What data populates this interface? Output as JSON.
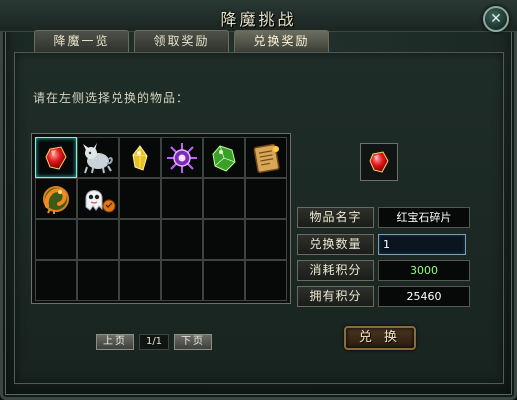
{
  "window": {
    "title": "降魔挑战"
  },
  "tabs": [
    {
      "label": "降魔一览",
      "active": false
    },
    {
      "label": "领取奖励",
      "active": false
    },
    {
      "label": "兑换奖励",
      "active": true
    }
  ],
  "prompt": "请在左侧选择兑换的物品：",
  "inventory": {
    "items": [
      {
        "icon": "red-gem-icon",
        "selected": true
      },
      {
        "icon": "white-mount-icon",
        "selected": false
      },
      {
        "icon": "yellow-crystal-icon",
        "selected": false
      },
      {
        "icon": "purple-orb-icon",
        "selected": false
      },
      {
        "icon": "green-crystal-icon",
        "selected": false
      },
      {
        "icon": "scroll-book-icon",
        "selected": false
      },
      {
        "icon": "orange-lizard-pet-icon",
        "selected": false
      },
      {
        "icon": "ghost-pet-icon",
        "selected": false
      }
    ],
    "slots": 24
  },
  "preview": {
    "icon": "red-gem-icon"
  },
  "info": {
    "name_label": "物品名字",
    "name_value": "红宝石碎片",
    "qty_label": "兑换数量",
    "qty_value": "1",
    "cost_label": "消耗积分",
    "cost_value": "3000",
    "owned_label": "拥有积分",
    "owned_value": "25460"
  },
  "pager": {
    "prev_label": "上页",
    "page": "1/1",
    "next_label": "下页"
  },
  "redeem_label": "兑 换",
  "colors": {
    "accent": "#7ef0d4",
    "cost_green": "#8cff7a",
    "frame": "#3a4740"
  }
}
